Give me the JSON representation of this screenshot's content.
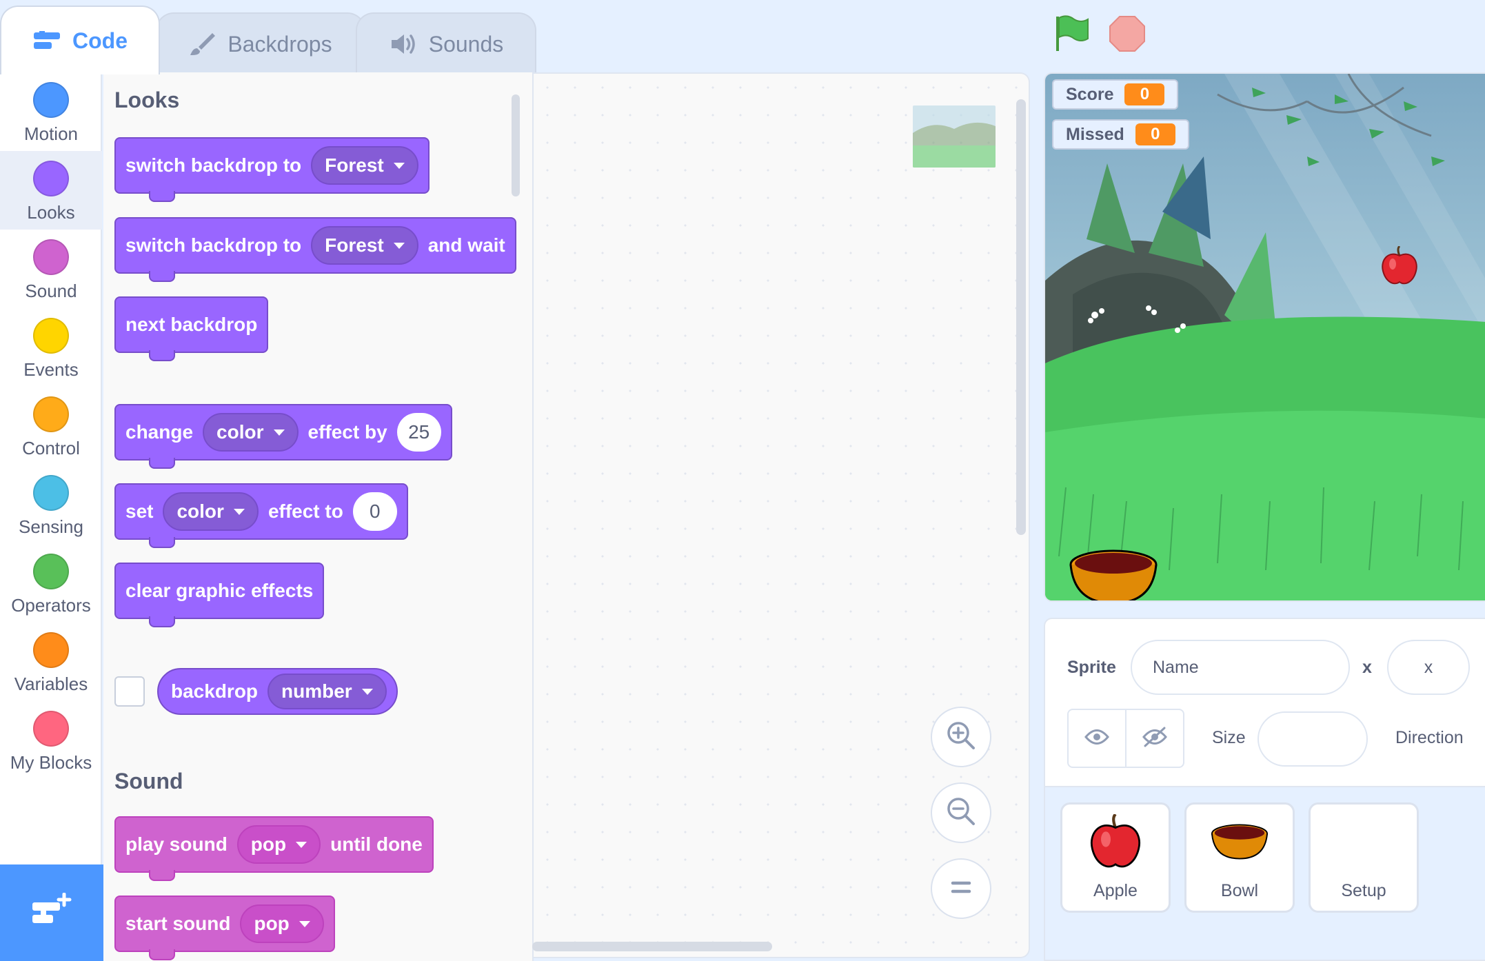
{
  "tabs": [
    {
      "label": "Code",
      "icon": "code-icon"
    },
    {
      "label": "Backdrops",
      "icon": "paintbrush-icon"
    },
    {
      "label": "Sounds",
      "icon": "speaker-icon"
    }
  ],
  "categories": [
    {
      "label": "Motion",
      "color": "#4c97ff"
    },
    {
      "label": "Looks",
      "color": "#9966ff"
    },
    {
      "label": "Sound",
      "color": "#cf63cf"
    },
    {
      "label": "Events",
      "color": "#ffd500"
    },
    {
      "label": "Control",
      "color": "#ffab19"
    },
    {
      "label": "Sensing",
      "color": "#4cbfe6"
    },
    {
      "label": "Operators",
      "color": "#59c059"
    },
    {
      "label": "Variables",
      "color": "#ff8c1a"
    },
    {
      "label": "My Blocks",
      "color": "#ff6680"
    }
  ],
  "palette": {
    "looks_heading": "Looks",
    "switch_backdrop": {
      "text": "switch backdrop to",
      "value": "Forest"
    },
    "switch_backdrop_wait": {
      "text": "switch backdrop to",
      "value": "Forest",
      "suffix": "and wait"
    },
    "next_backdrop": "next backdrop",
    "change_effect": {
      "text": "change",
      "effect": "color",
      "mid": "effect by",
      "value": "25"
    },
    "set_effect": {
      "text": "set",
      "effect": "color",
      "mid": "effect to",
      "value": "0"
    },
    "clear_effects": "clear graphic effects",
    "backdrop_reporter": {
      "text": "backdrop",
      "value": "number"
    },
    "sound_heading": "Sound",
    "play_sound": {
      "text": "play sound",
      "value": "pop",
      "suffix": "until done"
    },
    "start_sound": {
      "text": "start sound",
      "value": "pop"
    }
  },
  "stage": {
    "monitors": [
      {
        "label": "Score",
        "value": "0"
      },
      {
        "label": "Missed",
        "value": "0"
      }
    ]
  },
  "sprite_info": {
    "sprite_label": "Sprite",
    "name_placeholder": "Name",
    "x_label": "x",
    "x_placeholder": "x",
    "size_label": "Size",
    "direction_label": "Direction"
  },
  "sprites": [
    {
      "name": "Apple",
      "icon": "apple-icon"
    },
    {
      "name": "Bowl",
      "icon": "bowl-icon"
    },
    {
      "name": "Setup",
      "icon": ""
    }
  ],
  "colors": {
    "looks": "#9966ff",
    "sound": "#cf63cf",
    "accent": "#4c97ff",
    "monitor_value": "#ff8c1a"
  }
}
